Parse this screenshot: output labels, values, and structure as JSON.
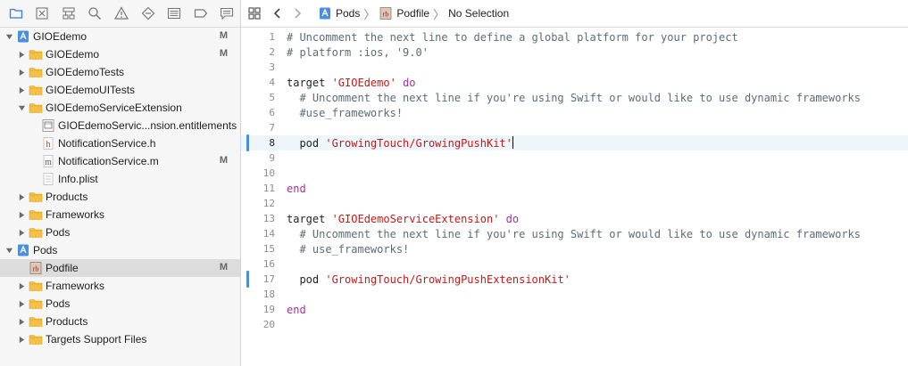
{
  "navigator": {
    "tabs": [
      {
        "name": "project-navigator-tab",
        "icon": "folder-icon",
        "active": true
      },
      {
        "name": "source-control-tab",
        "icon": "source-control-icon",
        "active": false
      },
      {
        "name": "symbol-navigator-tab",
        "icon": "hierarchy-icon",
        "active": false
      },
      {
        "name": "find-navigator-tab",
        "icon": "search-icon",
        "active": false
      },
      {
        "name": "issue-navigator-tab",
        "icon": "warning-icon",
        "active": false
      },
      {
        "name": "test-navigator-tab",
        "icon": "diamond-icon",
        "active": false
      },
      {
        "name": "debug-navigator-tab",
        "icon": "list-icon",
        "active": false
      },
      {
        "name": "breakpoint-navigator-tab",
        "icon": "breakpoint-icon",
        "active": false
      },
      {
        "name": "report-navigator-tab",
        "icon": "speech-bubble-icon",
        "active": false
      }
    ],
    "tree": [
      {
        "label": "GIOEdemo",
        "icon": "project-icon",
        "indent": 0,
        "disclosure": "open",
        "badge": "M",
        "selected": false
      },
      {
        "label": "GIOEdemo",
        "icon": "folder-icon",
        "indent": 1,
        "disclosure": "closed",
        "badge": "M",
        "selected": false
      },
      {
        "label": "GIOEdemoTests",
        "icon": "folder-icon",
        "indent": 1,
        "disclosure": "closed",
        "badge": "",
        "selected": false
      },
      {
        "label": "GIOEdemoUITests",
        "icon": "folder-icon",
        "indent": 1,
        "disclosure": "closed",
        "badge": "",
        "selected": false
      },
      {
        "label": "GIOEdemoServiceExtension",
        "icon": "folder-icon",
        "indent": 1,
        "disclosure": "open",
        "badge": "",
        "selected": false
      },
      {
        "label": "GIOEdemoServic...nsion.entitlements",
        "icon": "entitlements-file-icon",
        "indent": 2,
        "disclosure": "none",
        "badge": "",
        "selected": false
      },
      {
        "label": "NotificationService.h",
        "icon": "header-file-icon",
        "indent": 2,
        "disclosure": "none",
        "badge": "",
        "selected": false
      },
      {
        "label": "NotificationService.m",
        "icon": "objc-file-icon",
        "indent": 2,
        "disclosure": "none",
        "badge": "M",
        "selected": false
      },
      {
        "label": "Info.plist",
        "icon": "plist-file-icon",
        "indent": 2,
        "disclosure": "none",
        "badge": "",
        "selected": false
      },
      {
        "label": "Products",
        "icon": "folder-icon",
        "indent": 1,
        "disclosure": "closed",
        "badge": "",
        "selected": false
      },
      {
        "label": "Frameworks",
        "icon": "folder-icon",
        "indent": 1,
        "disclosure": "closed",
        "badge": "",
        "selected": false
      },
      {
        "label": "Pods",
        "icon": "folder-icon",
        "indent": 1,
        "disclosure": "closed",
        "badge": "",
        "selected": false
      },
      {
        "label": "Pods",
        "icon": "project-icon",
        "indent": 0,
        "disclosure": "open",
        "badge": "",
        "selected": false
      },
      {
        "label": "Podfile",
        "icon": "ruby-file-icon",
        "indent": 1,
        "disclosure": "none",
        "badge": "M",
        "selected": true
      },
      {
        "label": "Frameworks",
        "icon": "folder-icon",
        "indent": 1,
        "disclosure": "closed",
        "badge": "",
        "selected": false
      },
      {
        "label": "Pods",
        "icon": "folder-icon",
        "indent": 1,
        "disclosure": "closed",
        "badge": "",
        "selected": false
      },
      {
        "label": "Products",
        "icon": "folder-icon",
        "indent": 1,
        "disclosure": "closed",
        "badge": "",
        "selected": false
      },
      {
        "label": "Targets Support Files",
        "icon": "folder-icon",
        "indent": 1,
        "disclosure": "closed",
        "badge": "",
        "selected": false
      }
    ]
  },
  "jumpbar": {
    "grid_icon": "grid-icon",
    "back_icon": "chevron-left-icon",
    "forward_icon": "chevron-right-icon",
    "crumbs": [
      {
        "label": "Pods",
        "icon": "project-icon"
      },
      {
        "label": "Podfile",
        "icon": "ruby-file-icon"
      },
      {
        "label": "No Selection",
        "icon": ""
      }
    ]
  },
  "editor": {
    "current_line": 8,
    "changed_lines": [
      8,
      17
    ],
    "lines": [
      {
        "n": "1",
        "tokens": [
          {
            "t": "# Uncomment the next line to define a global platform for your project",
            "c": "comment"
          }
        ]
      },
      {
        "n": "2",
        "tokens": [
          {
            "t": "# platform :ios, '9.0'",
            "c": "comment"
          }
        ]
      },
      {
        "n": "3",
        "tokens": []
      },
      {
        "n": "4",
        "tokens": [
          {
            "t": "target ",
            "c": "plain"
          },
          {
            "t": "'GIOEdemo'",
            "c": "string"
          },
          {
            "t": " ",
            "c": "plain"
          },
          {
            "t": "do",
            "c": "keyword"
          }
        ]
      },
      {
        "n": "5",
        "tokens": [
          {
            "t": "  # Uncomment the next line if you're using Swift or would like to use dynamic frameworks",
            "c": "comment"
          }
        ]
      },
      {
        "n": "6",
        "tokens": [
          {
            "t": "  #use_frameworks!",
            "c": "comment"
          }
        ]
      },
      {
        "n": "7",
        "tokens": []
      },
      {
        "n": "8",
        "tokens": [
          {
            "t": "  pod ",
            "c": "plain"
          },
          {
            "t": "'GrowingTouch/GrowingPushKit'",
            "c": "string"
          }
        ]
      },
      {
        "n": "9",
        "tokens": []
      },
      {
        "n": "10",
        "tokens": []
      },
      {
        "n": "11",
        "tokens": [
          {
            "t": "end",
            "c": "keyword"
          }
        ]
      },
      {
        "n": "12",
        "tokens": []
      },
      {
        "n": "13",
        "tokens": [
          {
            "t": "target ",
            "c": "plain"
          },
          {
            "t": "'GIOEdemoServiceExtension'",
            "c": "string"
          },
          {
            "t": " ",
            "c": "plain"
          },
          {
            "t": "do",
            "c": "keyword"
          }
        ]
      },
      {
        "n": "14",
        "tokens": [
          {
            "t": "  # Uncomment the next line if you're using Swift or would like to use dynamic frameworks",
            "c": "comment"
          }
        ]
      },
      {
        "n": "15",
        "tokens": [
          {
            "t": "  # use_frameworks!",
            "c": "comment"
          }
        ]
      },
      {
        "n": "16",
        "tokens": []
      },
      {
        "n": "17",
        "tokens": [
          {
            "t": "  pod ",
            "c": "plain"
          },
          {
            "t": "'GrowingTouch/GrowingPushExtensionKit'",
            "c": "string"
          }
        ]
      },
      {
        "n": "18",
        "tokens": []
      },
      {
        "n": "19",
        "tokens": [
          {
            "t": "end",
            "c": "keyword"
          }
        ]
      },
      {
        "n": "20",
        "tokens": []
      }
    ]
  },
  "colors": {
    "accent": "#3a7bd5",
    "keyword": "#a8309d",
    "string": "#c41a16",
    "comment": "#5d6c79",
    "folder": "#f5c144",
    "change_marker": "#4d8fd6"
  }
}
